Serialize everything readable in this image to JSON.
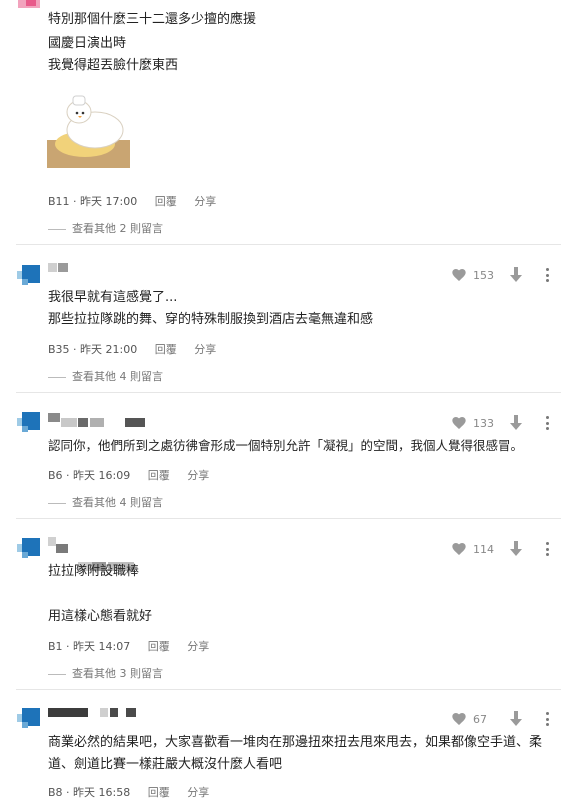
{
  "top_partial": {
    "lines": [
      "特別那個什麼三十二還多少擅的應援",
      "國慶日演出時",
      "我覺得超丟臉什麼東西"
    ],
    "meta": {
      "floor": "B11",
      "time": "昨天 17:00",
      "reply": "回覆",
      "share": "分享"
    },
    "more": "查看其他 2 則留言"
  },
  "comments": [
    {
      "likes": "153",
      "lines": [
        "我很早就有這感覺了...",
        "那些拉拉隊跳的舞、穿的特殊制服換到酒店去毫無違和感"
      ],
      "meta": {
        "floor": "B35",
        "time": "昨天 21:00",
        "reply": "回覆",
        "share": "分享"
      },
      "more": "查看其他 4 則留言"
    },
    {
      "likes": "133",
      "lines": [
        "認同你，他們所到之處彷彿會形成一個特別允許「凝視」的空間，我個人覺得很感冒。"
      ],
      "meta": {
        "floor": "B6",
        "time": "昨天 16:09",
        "reply": "回覆",
        "share": "分享"
      },
      "more": "查看其他 4 則留言"
    },
    {
      "likes": "114",
      "lines": [
        "拉拉隊附設職棒",
        "用這樣心態看就好"
      ],
      "meta": {
        "floor": "B1",
        "time": "昨天 14:07",
        "reply": "回覆",
        "share": "分享"
      },
      "more": "查看其他 3 則留言"
    },
    {
      "likes": "67",
      "lines": [
        "商業必然的結果吧，大家喜歡看一堆肉在那邊扭來扭去甩來甩去，如果都像空手道、柔",
        "道、劍道比賽一樣莊嚴大概沒什麼人看吧"
      ],
      "meta": {
        "floor": "B8",
        "time": "昨天 16:58",
        "reply": "回覆",
        "share": "分享"
      }
    }
  ],
  "colors": {
    "avatar_blue": "#1e73b9",
    "avatar_pink": "#e85a8a",
    "sticker_bg": "#c9a572"
  },
  "icons": {
    "like": "heart-icon",
    "dislike": "arrow-down-icon",
    "menu": "more-vertical-icon"
  }
}
